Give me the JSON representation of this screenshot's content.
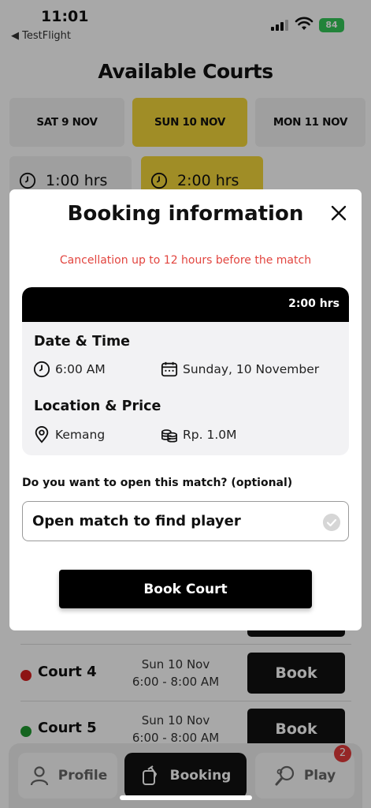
{
  "status_bar": {
    "time": "11:01",
    "back_label": "◀ TestFlight",
    "battery": "84"
  },
  "page": {
    "title": "Available Courts"
  },
  "dates": [
    {
      "label": "SAT 9 NOV",
      "active": false
    },
    {
      "label": "SUN 10 NOV",
      "active": true
    },
    {
      "label": "MON 11 NOV",
      "active": false
    }
  ],
  "durations": [
    {
      "label": "1:00 hrs",
      "active": false
    },
    {
      "label": "2:00 hrs",
      "active": true
    }
  ],
  "courts": [
    {
      "name": "Court 4",
      "status_color": "#d61f1f",
      "date": "Sun 10 Nov",
      "time": "6:00 - 8:00 AM",
      "book_label": "Book"
    },
    {
      "name": "Court 5",
      "status_color": "#1f9a2f",
      "date": "Sun 10 Nov",
      "time": "6:00 - 8:00 AM",
      "book_label": "Book"
    }
  ],
  "tabbar": {
    "profile_label": "Profile",
    "booking_label": "Booking",
    "play_label": "Play",
    "play_badge": "2"
  },
  "modal": {
    "title": "Booking information",
    "cancellation_notice": "Cancellation up to 12 hours before the match",
    "duration": "2:00 hrs",
    "date_time_heading": "Date & Time",
    "time": "6:00 AM",
    "date": "Sunday, 10 November",
    "location_price_heading": "Location & Price",
    "location": "Kemang",
    "price": "Rp. 1.0M",
    "open_match_question": "Do you want to open this match? (optional)",
    "open_match_option": "Open match to find player",
    "book_court_label": "Book Court"
  },
  "colors": {
    "accent_yellow": "#f3d63a",
    "notice_red": "#e2453f",
    "primary_black": "#000000"
  }
}
